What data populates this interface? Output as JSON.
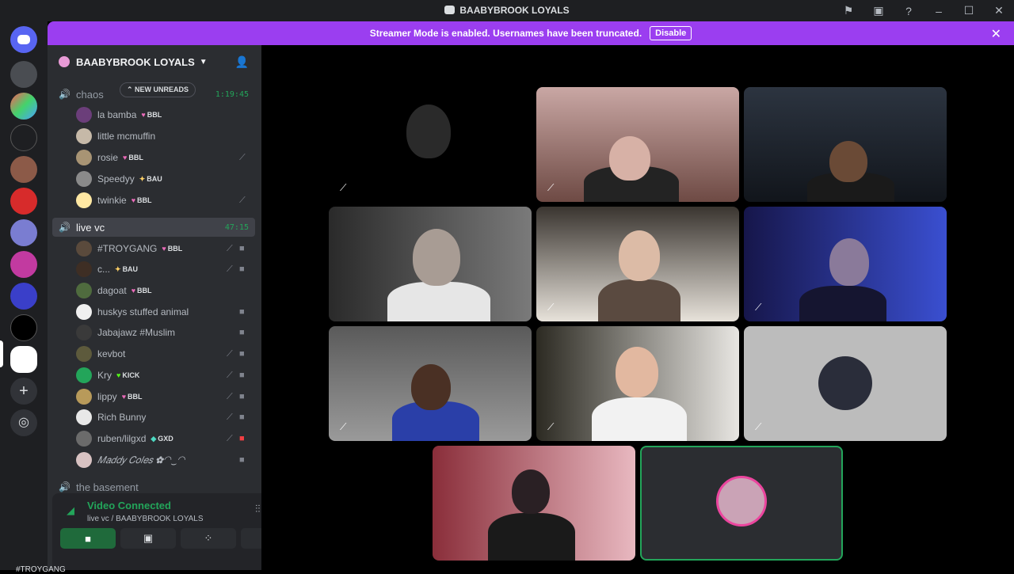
{
  "window": {
    "title": "BAABYBROOK LOYALS"
  },
  "banner": {
    "text": "Streamer Mode is enabled. Usernames have been truncated.",
    "button_label": "Disable",
    "close_icon": "close-icon"
  },
  "guild": {
    "name": "BAABYBROOK LOYALS",
    "invite_icon": "add-member-icon"
  },
  "channels": [
    {
      "name": "chaos",
      "timer": "1:19:45",
      "badge": "NEW UNREADS",
      "users": [
        {
          "name": "la bamba",
          "tag": "BBL"
        },
        {
          "name": "little mcmuffin",
          "tag": ""
        },
        {
          "name": "rosie",
          "tag": "BBL"
        },
        {
          "name": "Speedyy",
          "tag": "BAU"
        },
        {
          "name": "twinkie",
          "tag": "BBL"
        }
      ]
    },
    {
      "name": "live vc",
      "timer": "47:15",
      "users": [
        {
          "name": "#TROYGANG",
          "tag": "BBL"
        },
        {
          "name": "c...",
          "tag": "BAU"
        },
        {
          "name": "dagoat",
          "tag": "BBL"
        },
        {
          "name": "huskys stuffed animal",
          "tag": ""
        },
        {
          "name": "Jabajawz #Muslim",
          "tag": ""
        },
        {
          "name": "kevbot",
          "tag": ""
        },
        {
          "name": "Kry",
          "tag": "KICK"
        },
        {
          "name": "lippy",
          "tag": "BBL"
        },
        {
          "name": "Rich Bunny",
          "tag": ""
        },
        {
          "name": "ruben/lilgxd",
          "tag": "GXD"
        },
        {
          "name": "𝑀𝑎𝑑𝑑𝑦 𝐶𝑜𝑙𝑒𝑠 ✿◠‿◠",
          "tag": ""
        }
      ]
    },
    {
      "name": "the basement"
    }
  ],
  "voice": {
    "status": "Video Connected",
    "location": "live vc / BAABYBROOK LOYALS",
    "bottom_user": "#TROYGANG"
  },
  "colors": {
    "banner": "#9b3ef0",
    "connected": "#23a55a",
    "sidebar": "#2b2d31",
    "rail": "#1e1f22"
  }
}
